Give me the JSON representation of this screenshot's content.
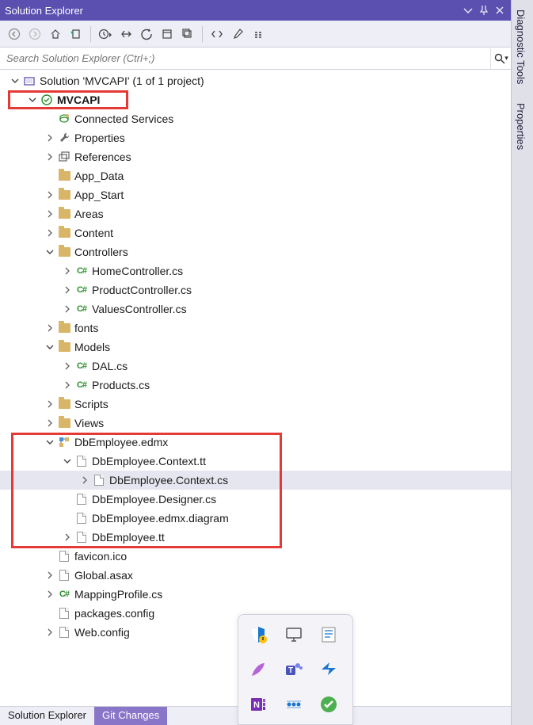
{
  "title": "Solution Explorer",
  "search": {
    "placeholder": "Search Solution Explorer (Ctrl+;)"
  },
  "solution_label": "Solution 'MVCAPI' (1 of 1 project)",
  "side_tabs": [
    {
      "label": "Diagnostic Tools"
    },
    {
      "label": "Properties"
    }
  ],
  "tree": [
    {
      "label": "MVCAPI",
      "indent": 1,
      "exp": "open",
      "bold": true,
      "icon": "project"
    },
    {
      "label": "Connected Services",
      "indent": 2,
      "exp": "none",
      "icon": "connected"
    },
    {
      "label": "Properties",
      "indent": 2,
      "exp": "closed",
      "icon": "wrench"
    },
    {
      "label": "References",
      "indent": 2,
      "exp": "closed",
      "icon": "refs"
    },
    {
      "label": "App_Data",
      "indent": 2,
      "exp": "none",
      "icon": "folder"
    },
    {
      "label": "App_Start",
      "indent": 2,
      "exp": "closed",
      "icon": "folder"
    },
    {
      "label": "Areas",
      "indent": 2,
      "exp": "closed",
      "icon": "folder"
    },
    {
      "label": "Content",
      "indent": 2,
      "exp": "closed",
      "icon": "folder"
    },
    {
      "label": "Controllers",
      "indent": 2,
      "exp": "open",
      "icon": "folder"
    },
    {
      "label": "HomeController.cs",
      "indent": 3,
      "exp": "closed",
      "icon": "cs"
    },
    {
      "label": "ProductController.cs",
      "indent": 3,
      "exp": "closed",
      "icon": "cs"
    },
    {
      "label": "ValuesController.cs",
      "indent": 3,
      "exp": "closed",
      "icon": "cs"
    },
    {
      "label": "fonts",
      "indent": 2,
      "exp": "closed",
      "icon": "folder"
    },
    {
      "label": "Models",
      "indent": 2,
      "exp": "open",
      "icon": "folder"
    },
    {
      "label": "DAL.cs",
      "indent": 3,
      "exp": "closed",
      "icon": "cs"
    },
    {
      "label": "Products.cs",
      "indent": 3,
      "exp": "closed",
      "icon": "cs"
    },
    {
      "label": "Scripts",
      "indent": 2,
      "exp": "closed",
      "icon": "folder"
    },
    {
      "label": "Views",
      "indent": 2,
      "exp": "closed",
      "icon": "folder"
    },
    {
      "label": "DbEmployee.edmx",
      "indent": 2,
      "exp": "open",
      "icon": "edmx"
    },
    {
      "label": "DbEmployee.Context.tt",
      "indent": 3,
      "exp": "open",
      "icon": "file"
    },
    {
      "label": "DbEmployee.Context.cs",
      "indent": 4,
      "exp": "closed",
      "icon": "file",
      "selected": true
    },
    {
      "label": "DbEmployee.Designer.cs",
      "indent": 3,
      "exp": "none",
      "icon": "file"
    },
    {
      "label": "DbEmployee.edmx.diagram",
      "indent": 3,
      "exp": "none",
      "icon": "file"
    },
    {
      "label": "DbEmployee.tt",
      "indent": 3,
      "exp": "closed",
      "icon": "file"
    },
    {
      "label": "favicon.ico",
      "indent": 2,
      "exp": "none",
      "icon": "file"
    },
    {
      "label": "Global.asax",
      "indent": 2,
      "exp": "closed",
      "icon": "file"
    },
    {
      "label": "MappingProfile.cs",
      "indent": 2,
      "exp": "closed",
      "icon": "cs"
    },
    {
      "label": "packages.config",
      "indent": 2,
      "exp": "none",
      "icon": "file"
    },
    {
      "label": "Web.config",
      "indent": 2,
      "exp": "closed",
      "icon": "file"
    }
  ],
  "bottom_tabs": [
    {
      "label": "Solution Explorer",
      "active": true
    },
    {
      "label": "Git Changes",
      "active": false
    }
  ],
  "taskbar_icons": [
    "shield",
    "monitor",
    "notepad",
    "feather",
    "teams",
    "power",
    "onenote",
    "dots",
    "check"
  ]
}
